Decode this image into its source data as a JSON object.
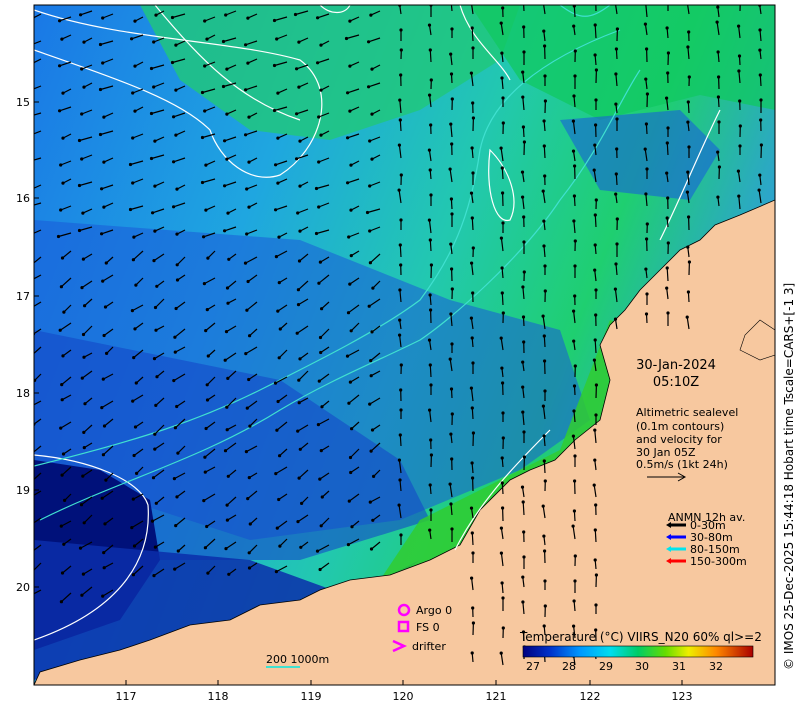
{
  "map": {
    "date": "30-Jan-2024",
    "time": "05:10Z",
    "x_ticks": [
      "117",
      "118",
      "119",
      "120",
      "121",
      "122",
      "123"
    ],
    "y_ticks": [
      "15",
      "16",
      "17",
      "18",
      "19",
      "20"
    ],
    "annotation": {
      "line1": "Altimetric sealevel",
      "line2": "(0.1m contours)",
      "line3": "and velocity for",
      "line4": "30 Jan 05Z",
      "line5": "0.5m/s (1kt 24h)"
    },
    "anmn": {
      "title": "ANMN 12h av.",
      "items": [
        {
          "label": "0-30m",
          "color": "#000000"
        },
        {
          "label": "30-80m",
          "color": "#0000ff"
        },
        {
          "label": "80-150m",
          "color": "#00e5ee"
        },
        {
          "label": "150-300m",
          "color": "#ff0000"
        }
      ]
    },
    "obs_legend": {
      "argo": "Argo 0",
      "fs": "FS 0",
      "drifter": "drifter"
    },
    "isobath_label": "200  1000m",
    "colorbar": {
      "title": "Temperature (°C) VIIRS_N20 60% ql>=2",
      "ticks": [
        "27",
        "28",
        "29",
        "30",
        "31",
        "32"
      ]
    },
    "credit": "© IMOS 25-Dec-2025 15:44:18 Hobart time Tscale=CARS+[-1 3]",
    "colors": {
      "land": "#f7c89f",
      "magenta": "#ff00ff",
      "contour": "#ffffff",
      "isobath": "#40e0d0"
    }
  }
}
